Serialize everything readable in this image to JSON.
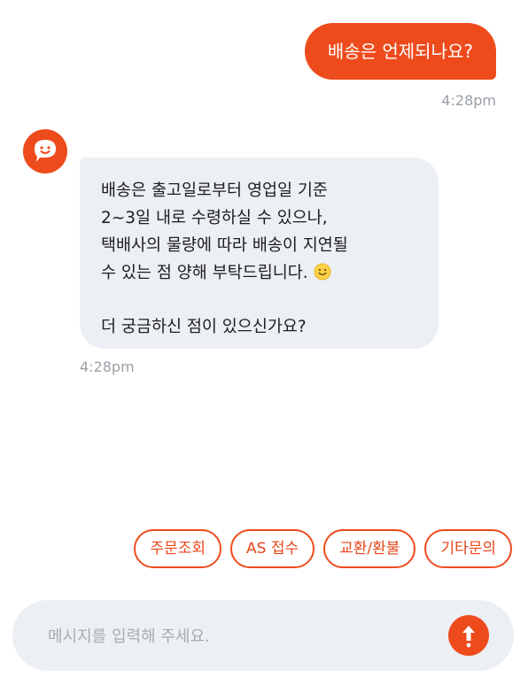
{
  "user_message": {
    "text": "배송은 언제되나요?",
    "time": "4:28pm"
  },
  "bot_message": {
    "lines": [
      "배송은 출고일로부터 영업일 기준",
      "2~3일 내로 수령하실 수 있으나,",
      "택배사의 물량에 따라 배송이 지연될",
      "수 있는 점 양해 부탁드립니다.",
      "더 궁금하신 점이 있으신가요?"
    ],
    "emoji": "slightly-smiling-face",
    "time": "4:28pm"
  },
  "quick_replies": [
    "주문조회",
    "AS 접수",
    "교환/환불",
    "기타문의"
  ],
  "composer": {
    "placeholder": "메시지를 입력해 주세요.",
    "value": ""
  },
  "colors": {
    "accent": "#ee4b1d",
    "bubble_bg": "#eceff3",
    "timestamp": "#9aa0a6"
  },
  "icons": {
    "avatar": "chat-bubble-smile-icon",
    "send": "arrow-up-icon"
  }
}
